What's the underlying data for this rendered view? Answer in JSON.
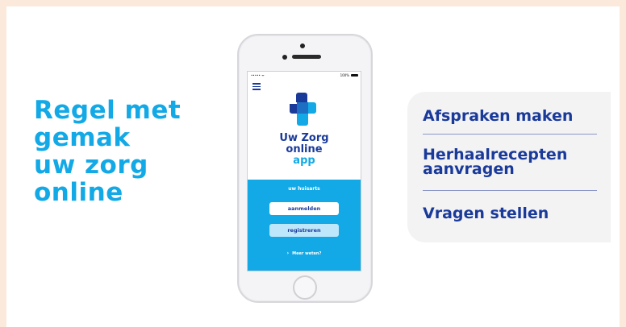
{
  "headline": {
    "line1": "Regel met",
    "line2": "gemak",
    "line3": "uw zorg",
    "line4": "online"
  },
  "phone": {
    "status": {
      "left": "••••• ᯤ",
      "time": "",
      "battery": "100%"
    },
    "app_name": {
      "line1": "Uw Zorg",
      "line2": "online",
      "line3": "app"
    },
    "section_label": "uw huisarts",
    "login_button": "aanmelden",
    "register_button": "registreren",
    "more_link": "Meer weten?"
  },
  "features": [
    "Afspraken maken",
    "Herhaalrecepten",
    "aanvragen",
    "Vragen stellen"
  ],
  "colors": {
    "background": "#fbe9dc",
    "accent_blue": "#12a9e6",
    "dark_blue": "#1a3a9a",
    "panel_gray": "#f3f3f4"
  },
  "icons": {
    "logo": "medical-cross-logo",
    "menu": "hamburger-menu-icon",
    "chevron": "chevron-right-icon"
  }
}
